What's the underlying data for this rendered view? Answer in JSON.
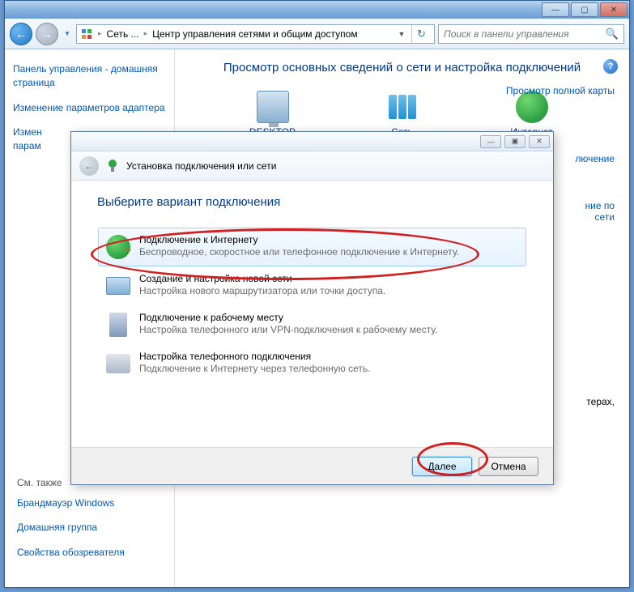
{
  "parent_window": {
    "titlebar": {
      "min": "—",
      "max": "▢",
      "close": "✕"
    },
    "toolbar": {
      "back_glyph": "←",
      "fwd_glyph": "→",
      "dropdown_glyph": "▼",
      "refresh_glyph": "↻",
      "search_placeholder": "Поиск в панели управления",
      "search_glyph": "🔍"
    },
    "breadcrumb": {
      "sep": "▸",
      "item1": "Сеть ...",
      "item2": "Центр управления сетями и общим доступом"
    },
    "sidebar": {
      "link1": "Панель управления - домашняя страница",
      "link2": "Изменение параметров адаптера",
      "link3": "Измен",
      "link3b": "парам",
      "see_also": "См. также",
      "bottom1": "Брандмауэр Windows",
      "bottom2": "Домашняя группа",
      "bottom3": "Свойства обозревателя"
    },
    "main": {
      "help_glyph": "?",
      "heading": "Просмотр основных сведений о сети и настройка подключений",
      "full_map_link": "Просмотр полной карты",
      "icons": {
        "desktop": "DESKTOP",
        "network": "Сеть",
        "internet": "Интернет"
      },
      "partial_right_1": "лючение",
      "partial_right_2a": "ние по",
      "partial_right_2b": "сети",
      "partial_right_3": "терах,"
    }
  },
  "dialog": {
    "titlebar": {
      "min": "—",
      "max": "▣",
      "close": "✕"
    },
    "back_glyph": "←",
    "icon_glyph": "🔌",
    "title": "Установка подключения или сети",
    "instruction": "Выберите вариант подключения",
    "options": {
      "o1_title": "Подключение к Интернету",
      "o1_desc": "Беспроводное, скоростное или телефонное подключение к Интернету.",
      "o2_title": "Создание и настройка новой сети",
      "o2_desc": "Настройка нового маршрутизатора или точки доступа.",
      "o3_title": "Подключение к рабочему месту",
      "o3_desc": "Настройка телефонного или VPN-подключения к рабочему месту.",
      "o4_title": "Настройка телефонного подключения",
      "o4_desc": "Подключение к Интернету через телефонную сеть."
    },
    "footer": {
      "next": "Далее",
      "cancel": "Отмена"
    }
  }
}
